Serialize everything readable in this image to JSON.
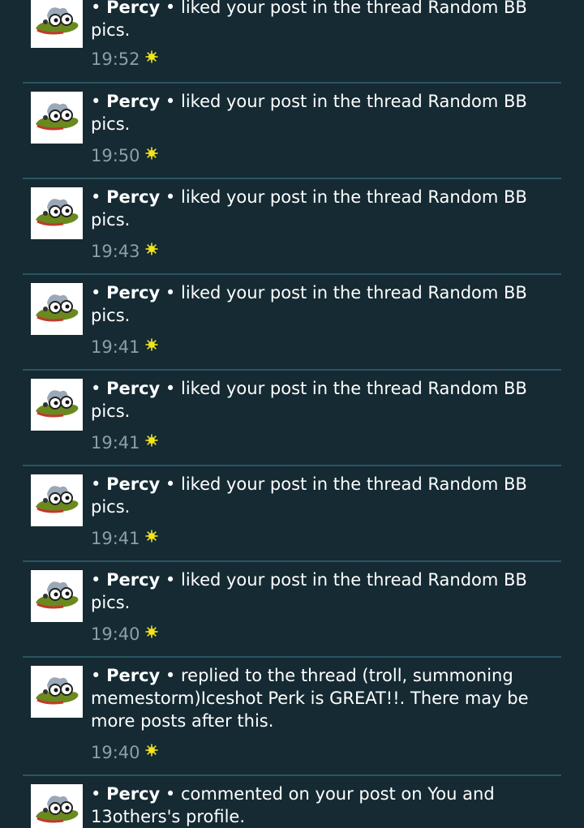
{
  "alerts": [
    {
      "bullet": "•",
      "user": "Percy",
      "sep": "•",
      "message": "liked your post in the thread Random BB pics.",
      "time": "19:52",
      "icon": "sun-icon"
    },
    {
      "bullet": "•",
      "user": "Percy",
      "sep": "•",
      "message": "liked your post in the thread Random BB pics.",
      "time": "19:50",
      "icon": "sun-icon"
    },
    {
      "bullet": "•",
      "user": "Percy",
      "sep": "•",
      "message": "liked your post in the thread Random BB pics.",
      "time": "19:43",
      "icon": "sun-icon"
    },
    {
      "bullet": "•",
      "user": "Percy",
      "sep": "•",
      "message": "liked your post in the thread Random BB pics.",
      "time": "19:41",
      "icon": "sun-icon"
    },
    {
      "bullet": "•",
      "user": "Percy",
      "sep": "•",
      "message": "liked your post in the thread Random BB pics.",
      "time": "19:41",
      "icon": "sun-icon"
    },
    {
      "bullet": "•",
      "user": "Percy",
      "sep": "•",
      "message": "liked your post in the thread Random BB pics.",
      "time": "19:41",
      "icon": "sun-icon"
    },
    {
      "bullet": "•",
      "user": "Percy",
      "sep": "•",
      "message": "liked your post in the thread Random BB pics.",
      "time": "19:40",
      "icon": "sun-icon"
    },
    {
      "bullet": "•",
      "user": "Percy",
      "sep": "•",
      "message": "replied to the thread (troll, summoning memestorm)Iceshot Perk is GREAT!!. There may be more posts after this.",
      "time": "19:40",
      "icon": "sun-icon"
    },
    {
      "bullet": "•",
      "user": "Percy",
      "sep": "•",
      "message": "commented on your post on You and 13others's profile.",
      "time": "",
      "icon": "sun-icon"
    }
  ],
  "colors": {
    "background": "#152a33",
    "divider": "#2b5563",
    "text": "#ffffff",
    "timestamp": "#8aa0a8",
    "sun": "#f2e31c"
  }
}
